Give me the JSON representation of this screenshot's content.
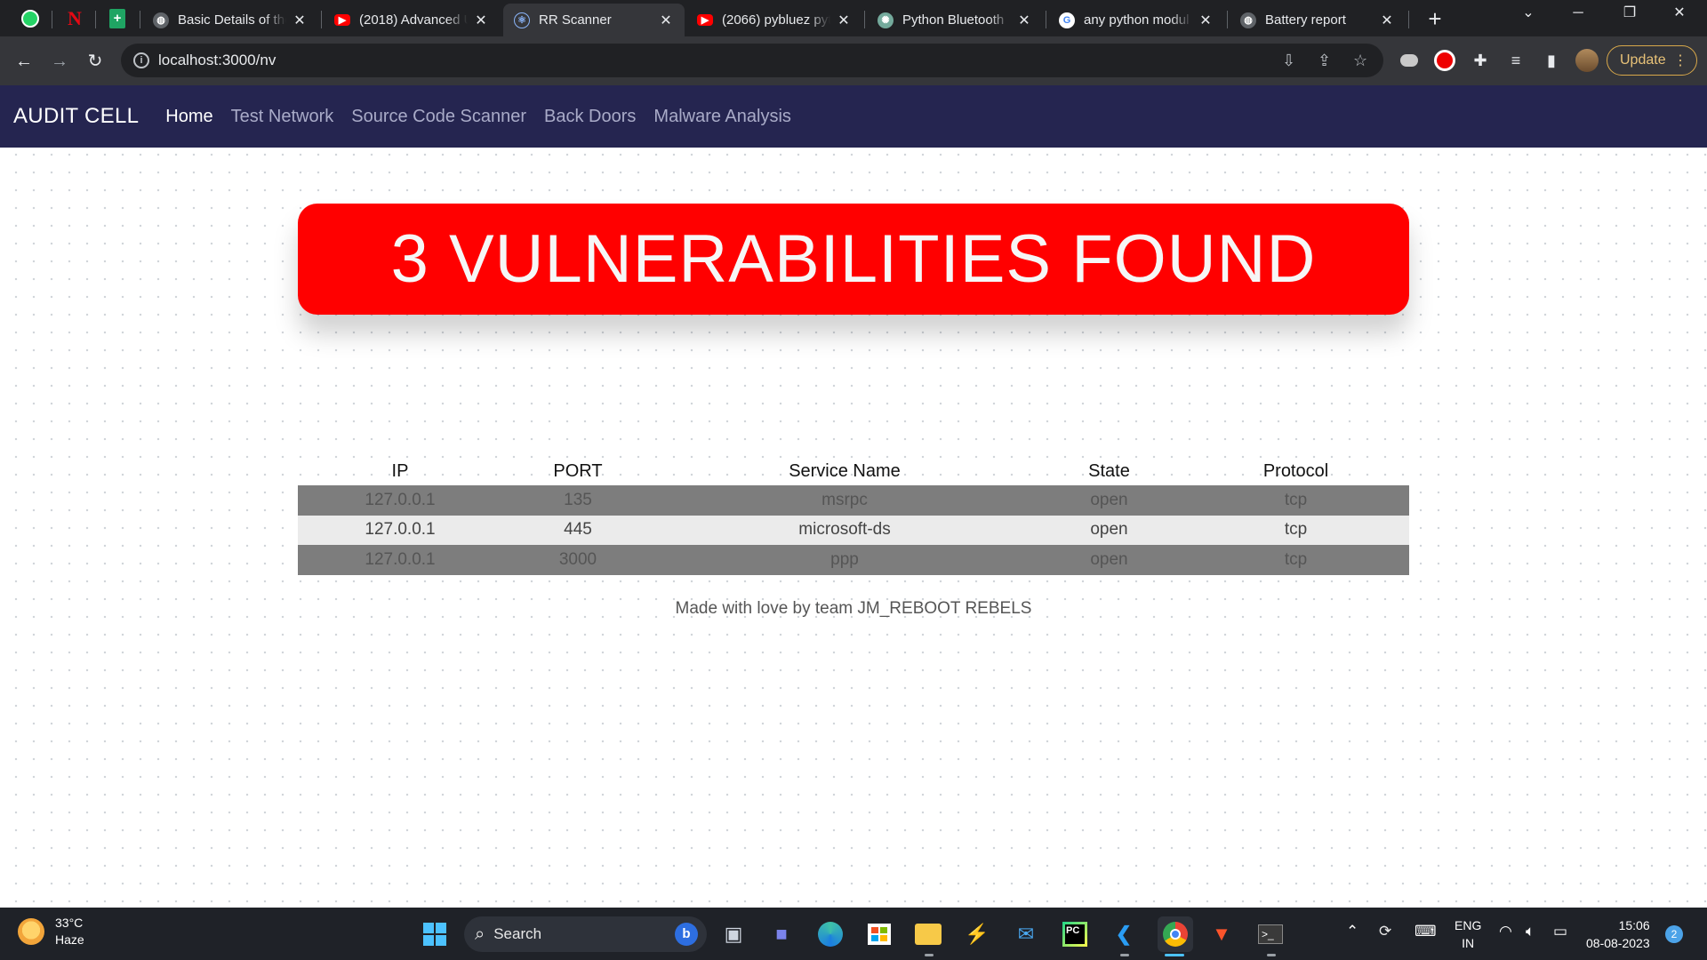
{
  "browser": {
    "tabs": [
      {
        "title": "Basic Details of the",
        "favicon": "globe-icon"
      },
      {
        "title": "(2018) Advanced U",
        "favicon": "youtube-icon"
      },
      {
        "title": "RR Scanner",
        "favicon": "react-icon",
        "active": true
      },
      {
        "title": "(2066) pybluez pyt",
        "favicon": "youtube-icon"
      },
      {
        "title": "Python Bluetooth",
        "favicon": "chatgpt-icon"
      },
      {
        "title": "any python modul",
        "favicon": "google-icon"
      },
      {
        "title": "Battery report",
        "favicon": "globe-icon"
      }
    ],
    "url": "localhost:3000/nv",
    "update_label": "Update"
  },
  "app": {
    "brand": "AUDIT CELL",
    "nav": [
      "Home",
      "Test Network",
      "Source Code Scanner",
      "Back Doors",
      "Malware Analysis"
    ],
    "banner": "3 VULNERABILITIES FOUND",
    "table": {
      "headers": [
        "IP",
        "PORT",
        "Service Name",
        "State",
        "Protocol"
      ],
      "rows": [
        [
          "127.0.0.1",
          "135",
          "msrpc",
          "open",
          "tcp"
        ],
        [
          "127.0.0.1",
          "445",
          "microsoft-ds",
          "open",
          "tcp"
        ],
        [
          "127.0.0.1",
          "3000",
          "ppp",
          "open",
          "tcp"
        ]
      ]
    },
    "footer": "Made with love by team JM_REBOOT REBELS"
  },
  "taskbar": {
    "temperature": "33°C",
    "condition": "Haze",
    "search_label": "Search",
    "lang_top": "ENG",
    "lang_bottom": "IN",
    "time": "15:06",
    "date": "08-08-2023",
    "notifications": "2"
  },
  "colors": {
    "banner": "#ff0000",
    "navbar": "#252550",
    "row_dark": "#7d7d7d",
    "row_light": "#ebebeb"
  }
}
